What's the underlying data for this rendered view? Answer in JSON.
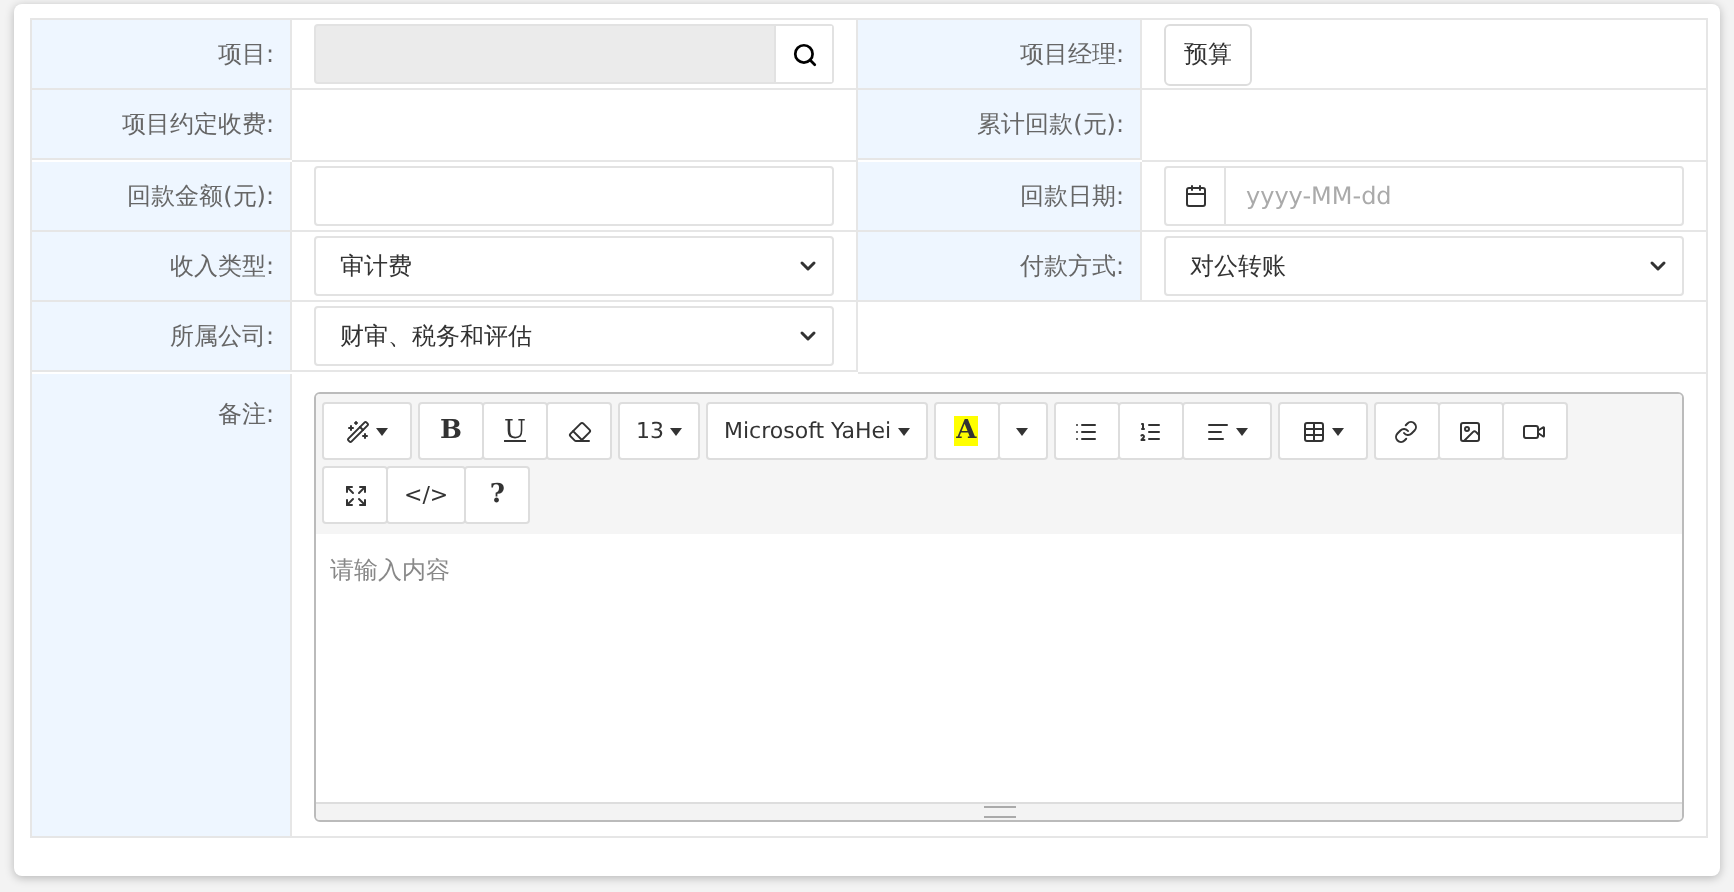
{
  "rows": [
    [
      {
        "label": "项目:",
        "control": {
          "kind": "search",
          "disabled": true
        }
      },
      {
        "label": "项目经理:",
        "control": {
          "kind": "button",
          "text": "预算"
        }
      }
    ],
    [
      {
        "label": "项目约定收费:"
      },
      {
        "label": "累计回款(元):"
      }
    ],
    [
      {
        "label": "回款金额(元):",
        "control": {
          "kind": "input"
        }
      },
      {
        "label": "回款日期:",
        "control": {
          "kind": "date",
          "placeholder": "yyyy-MM-dd"
        }
      }
    ],
    [
      {
        "label": "收入类型:",
        "control": {
          "kind": "select",
          "value": "审计费"
        }
      },
      {
        "label": "付款方式:",
        "control": {
          "kind": "select",
          "value": "对公转账"
        }
      }
    ],
    [
      {
        "label": "所属公司:",
        "control": {
          "kind": "select",
          "value": "财审、税务和评估"
        }
      }
    ]
  ],
  "remark": {
    "label": "备注:",
    "placeholder": "请输入内容",
    "toolbar_rows": [
      [
        [
          {
            "kind": "icon"
          }
        ],
        [
          {
            "kind": "text",
            "text": "B"
          },
          {
            "kind": "text",
            "text": "U"
          },
          {
            "kind": "icon"
          }
        ],
        [
          {
            "kind": "text",
            "text": "13"
          }
        ],
        [
          {
            "kind": "text",
            "text": "Microsoft YaHei"
          }
        ],
        [
          {
            "kind": "highlight",
            "text": "A"
          },
          {
            "kind": "caret"
          }
        ],
        [
          {
            "kind": "icon"
          },
          {
            "kind": "icon"
          },
          {
            "kind": "icon"
          }
        ],
        [
          {
            "kind": "icon"
          }
        ],
        [
          {
            "kind": "icon"
          },
          {
            "kind": "icon"
          },
          {
            "kind": "icon"
          }
        ]
      ],
      [
        [
          {
            "kind": "icon"
          },
          {
            "kind": "text",
            "text": "</>"
          },
          {
            "kind": "text",
            "text": "?"
          }
        ]
      ]
    ]
  }
}
